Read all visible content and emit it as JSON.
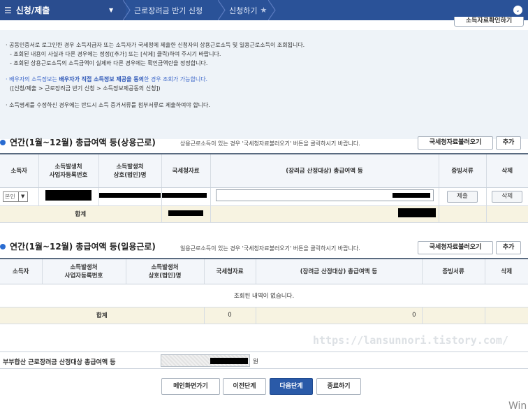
{
  "topbar": {
    "menu_label": "신청/제출",
    "crumb1": "근로장려금 반기 신청",
    "crumb2": "신청하기",
    "top_right_button": "소득자료확인하기"
  },
  "info": {
    "line1": "공동인증서로 로그인한 경우 소득지급자 또는 소득자가 국세청에 제출한 신청자의 상용근로소득 및 일용근로소득이 조회됩니다.",
    "line2": "- 조회된 내용이 사실과 다른 경우에는 정정([추가] 또는 [삭제] 클릭)하여 주시기 바랍니다.",
    "line3": "- 조회된 상용근로소득의 소득금액이 실제와 다른 경우에는 확인금액란을 정정합니다.",
    "line4_pre": "배우자의 소득정보는 ",
    "line4_bold": "배우자가 직접 소득정보 제공을 동의",
    "line4_post": "한 경우 조회가 가능합니다.",
    "line5": "([신청/제출 > 근로장려금 반기 신청 > 소득정보제공동의 신청])",
    "line6": "소득명세를 수정하신 경우에는 반드시 소득 증거서류를 첨부서류로 제출하여야 합니다."
  },
  "section1": {
    "title": "연간(1월~12월) 총급여액 등(상용근로)",
    "note": "상용근로소득이 있는 경우 '국세청자료불러오기' 버튼을 클릭하시기 바랍니다.",
    "load_button": "국세청자료불러오기",
    "add_button": "추가",
    "headers": [
      "소득자",
      "소득발생처\n사업자등록번호",
      "소득발생처\n상호(법인)명",
      "국세청자료",
      "(장려금 산정대상) 총급여액 등",
      "증빙서류",
      "삭제"
    ],
    "row": {
      "earner_select": "본인",
      "proof_button": "제출",
      "delete_button": "삭제"
    },
    "sum_label": "합계"
  },
  "section2": {
    "title": "연간(1월~12월) 총급여액 등(일용근로)",
    "note": "일용근로소득이 있는 경우 '국세청자료불러오기' 버튼을 클릭하시기 바랍니다.",
    "load_button": "국세청자료불러오기",
    "add_button": "추가",
    "headers": [
      "소득자",
      "소득발생처\n사업자등록번호",
      "소득발생처\n상호(법인)명",
      "국세청자료",
      "(장려금 산정대상) 총급여액 등",
      "증빙서류",
      "삭제"
    ],
    "empty_message": "조회된 내역이 없습니다.",
    "sum_label": "합계",
    "sum_nts": "0",
    "sum_total": "0"
  },
  "watermark": "https://lansunnori.tistory.com/",
  "total": {
    "label": "부부합산 근로장려금 산정대상 총급여액 등",
    "unit": "원"
  },
  "buttons": {
    "main": "메인화면가기",
    "prev": "이전단계",
    "next": "다음단계",
    "end": "종료하기"
  },
  "os_text": "Win"
}
